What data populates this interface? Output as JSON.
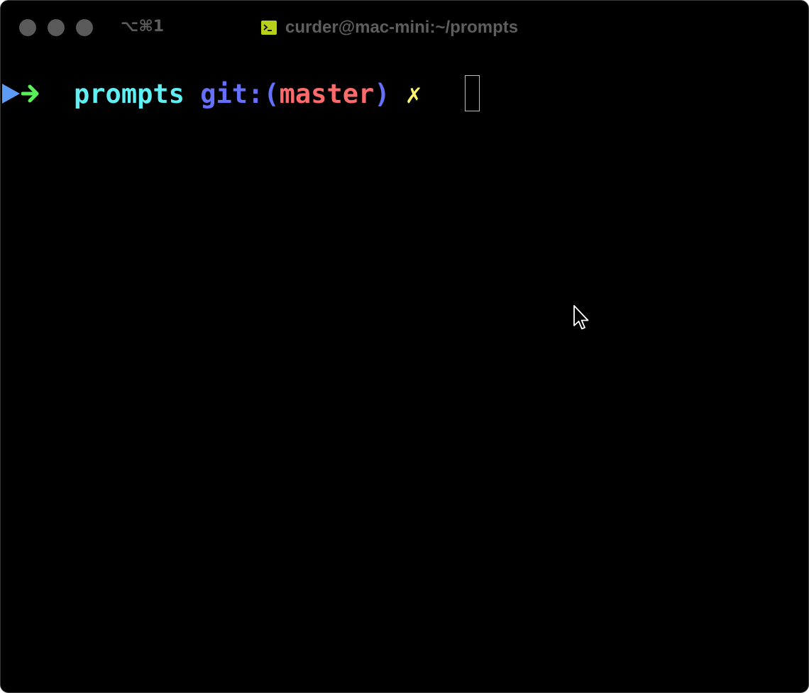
{
  "window": {
    "shortcut": "⌥⌘1",
    "title": "curder@mac-mini:~/prompts",
    "title_icon": "terminal-icon",
    "traffic_lights": [
      "close",
      "minimize",
      "zoom"
    ]
  },
  "prompt": {
    "directory": "prompts",
    "git_prefix": "git:",
    "paren_open": "(",
    "branch": "master",
    "paren_close": ")",
    "dirty_marker": "✗"
  },
  "colors": {
    "background": "#000000",
    "marker": "#5c9cf5",
    "arrow": "#58f258",
    "directory": "#5ff0f5",
    "git": "#6670ff",
    "branch": "#ff6b6b",
    "dirty": "#fbf36b"
  }
}
